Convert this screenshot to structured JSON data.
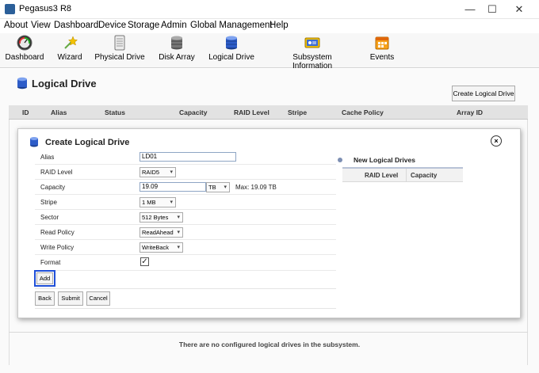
{
  "window": {
    "title": "Pegasus3 R8",
    "minimize": "—",
    "maximize": "☐",
    "close": "✕"
  },
  "menu": [
    "About",
    "View",
    "Dashboard",
    "Device",
    "Storage",
    "Admin",
    "Global Management",
    "Help"
  ],
  "toolbar": [
    {
      "label": "Dashboard",
      "icon": "dashboard-gauge-icon"
    },
    {
      "label": "Wizard",
      "icon": "wizard-icon"
    },
    {
      "label": "Physical Drive",
      "icon": "physical-drive-icon"
    },
    {
      "label": "Disk Array",
      "icon": "disk-array-icon"
    },
    {
      "label": "Logical Drive",
      "icon": "logical-drive-icon"
    },
    {
      "label": "Subsystem Information",
      "icon": "subsystem-info-icon"
    },
    {
      "label": "Events",
      "icon": "events-calendar-icon"
    }
  ],
  "page": {
    "title": "Logical Drive",
    "create_button": "Create Logical Drive",
    "columns": [
      "ID",
      "Alias",
      "Status",
      "Capacity",
      "RAID Level",
      "Stripe",
      "Cache Policy",
      "Array ID"
    ],
    "empty_message": "There are no configured logical drives in the subsystem."
  },
  "dialog": {
    "title": "Create Logical Drive",
    "close": "×",
    "fields": {
      "alias": {
        "label": "Alias",
        "value": "LD01"
      },
      "raid_level": {
        "label": "RAID Level",
        "value": "RAID5"
      },
      "capacity": {
        "label": "Capacity",
        "value": "19.09",
        "unit": "TB",
        "max": "Max: 19.09 TB"
      },
      "stripe": {
        "label": "Stripe",
        "value": "1 MB"
      },
      "sector": {
        "label": "Sector",
        "value": "512 Bytes"
      },
      "read_policy": {
        "label": "Read Policy",
        "value": "ReadAhead"
      },
      "write_policy": {
        "label": "Write Policy",
        "value": "WriteBack"
      },
      "format": {
        "label": "Format",
        "checked": true
      }
    },
    "add_button": "Add",
    "back_button": "Back",
    "submit_button": "Submit",
    "cancel_button": "Cancel",
    "new_drives": {
      "title": "New Logical Drives",
      "columns": [
        "RAID Level",
        "Capacity"
      ]
    }
  },
  "colors": {
    "highlight_border": "#1f4fd8",
    "header_bg": "#e2e2e2"
  }
}
